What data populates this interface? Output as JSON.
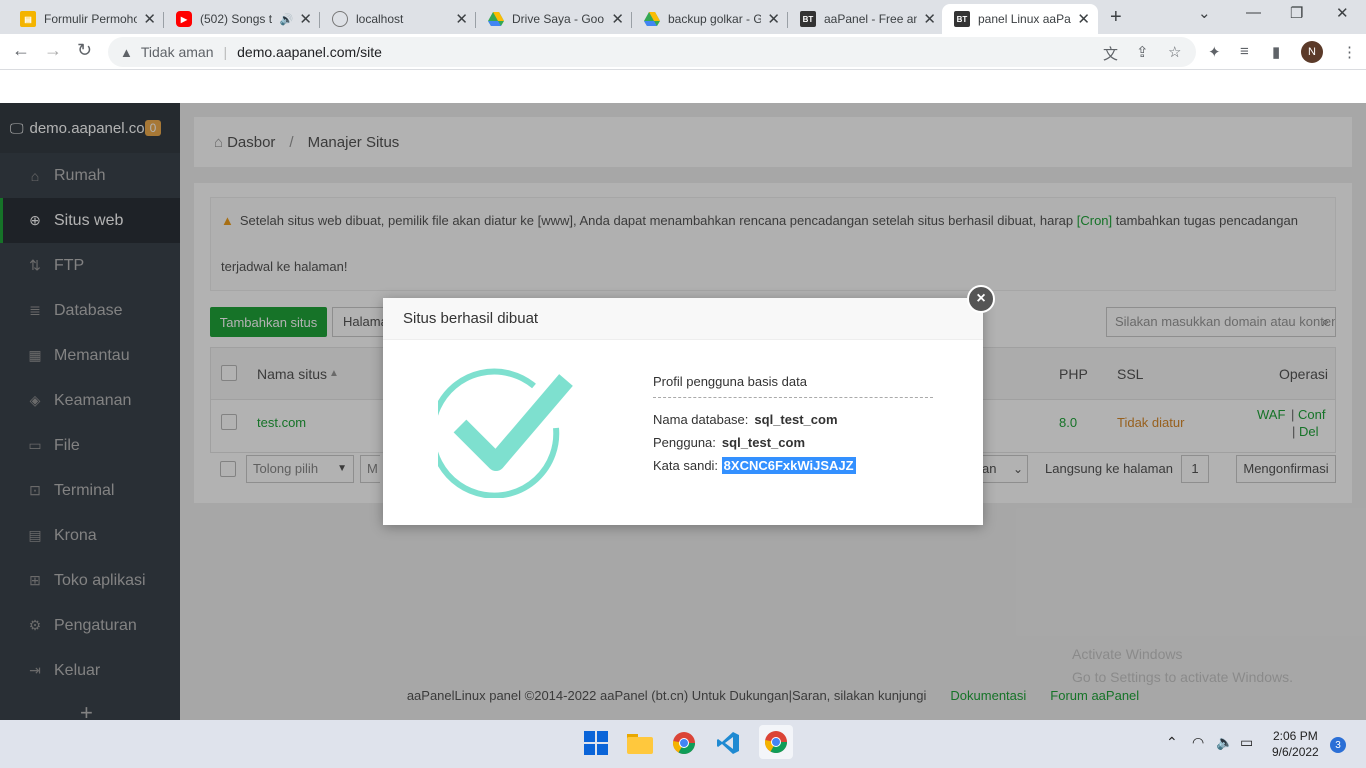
{
  "browser": {
    "tabs": [
      {
        "label": "Formulir Permohon",
        "icon": "forms-icon"
      },
      {
        "label": "(502) Songs t",
        "icon": "youtube-icon"
      },
      {
        "label": "localhost",
        "icon": "globe-icon"
      },
      {
        "label": "Drive Saya - Goo",
        "icon": "drive-icon"
      },
      {
        "label": "backup golkar - G",
        "icon": "drive-icon"
      },
      {
        "label": "aaPanel - Free an",
        "icon": "bt-icon"
      },
      {
        "label": "panel Linux aaPa",
        "icon": "bt-icon"
      }
    ],
    "new_tab": "+",
    "security_label": "Tidak aman",
    "url": "demo.aapanel.com/site",
    "profile_initial": "N"
  },
  "sidebar": {
    "brand": "demo.aapanel.co",
    "badge": "0",
    "items": [
      {
        "label": "Rumah"
      },
      {
        "label": "Situs web"
      },
      {
        "label": "FTP"
      },
      {
        "label": "Database"
      },
      {
        "label": "Memantau"
      },
      {
        "label": "Keamanan"
      },
      {
        "label": "File"
      },
      {
        "label": "Terminal"
      },
      {
        "label": "Krona"
      },
      {
        "label": "Toko aplikasi"
      },
      {
        "label": "Pengaturan"
      },
      {
        "label": "Keluar"
      }
    ],
    "plus": "+"
  },
  "breadcrumb": {
    "home": "Dasbor",
    "current": "Manajer Situs",
    "sep": "/"
  },
  "alert": {
    "text1": "Setelah situs web dibuat, pemilik file akan diatur ke [www], Anda dapat menambahkan rencana pencadangan setelah situs berhasil dibuat, harap",
    "cron": "[Cron]",
    "text2": "tambahkan tugas pencadangan",
    "text3": "terjadwal ke halaman!"
  },
  "toolbar": {
    "add_site": "Tambahkan situs",
    "secondary": "Halama",
    "search_placeholder": "Silakan masukkan domain atau konten"
  },
  "table": {
    "headers": {
      "name": "Nama situs",
      "php": "PHP",
      "ssl": "SSL",
      "ops": "Operasi"
    },
    "row": {
      "name": "test.com",
      "php": "8.0",
      "ssl": "Tidak diatur",
      "waf": "WAF",
      "conf": "Conf",
      "del": "Del",
      "pipe": "|"
    }
  },
  "pager": {
    "bulk": "Tolong pilih",
    "m": "M",
    "per_page": "an",
    "goto_label": "Langsung ke halaman",
    "goto_value": "1",
    "confirm": "Mengonfirmasi"
  },
  "footer": {
    "copyright": "aaPanelLinux panel ©2014-2022 aaPanel (bt.cn) Untuk Dukungan|Saran, silakan kunjungi",
    "docs": "Dokumentasi",
    "forum": "Forum aaPanel"
  },
  "watermark": {
    "line1": "Activate Windows",
    "line2": "Go to Settings to activate Windows."
  },
  "modal": {
    "title": "Situs berhasil dibuat",
    "close": "×",
    "profile_title": "Profil pengguna basis data",
    "db_label": "Nama database:",
    "db_value": "sql_test_com",
    "user_label": "Pengguna:",
    "user_value": "sql_test_com",
    "pass_label": "Kata sandi:",
    "pass_value": "8XCNC6FxkWiJSAJZ"
  },
  "taskbar": {
    "time": "2:06 PM",
    "date": "9/6/2022",
    "notifications": "3"
  },
  "colors": {
    "accent": "#20a53a",
    "check": "#7ee0cf",
    "highlight": "#3390ff"
  }
}
